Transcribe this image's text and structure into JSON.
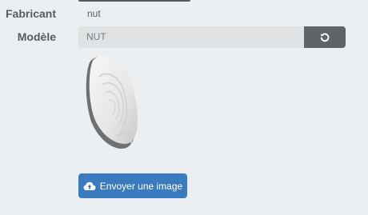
{
  "form": {
    "manufacturer_label": "Fabricant",
    "manufacturer_value": "nut",
    "model_label": "Modèle",
    "model_value": "NUT"
  },
  "buttons": {
    "reset_icon": "refresh-icon",
    "upload_label": "Envoyer une image",
    "upload_icon": "cloud-upload-icon"
  },
  "image": {
    "subject": "nut-tracker-device",
    "icon": "device-image"
  },
  "colors": {
    "background": "#eceff1",
    "label": "#555b61",
    "input_bg": "#e0e2e3",
    "reset_button": "#5f6468",
    "upload_button": "#3a7bbf"
  }
}
